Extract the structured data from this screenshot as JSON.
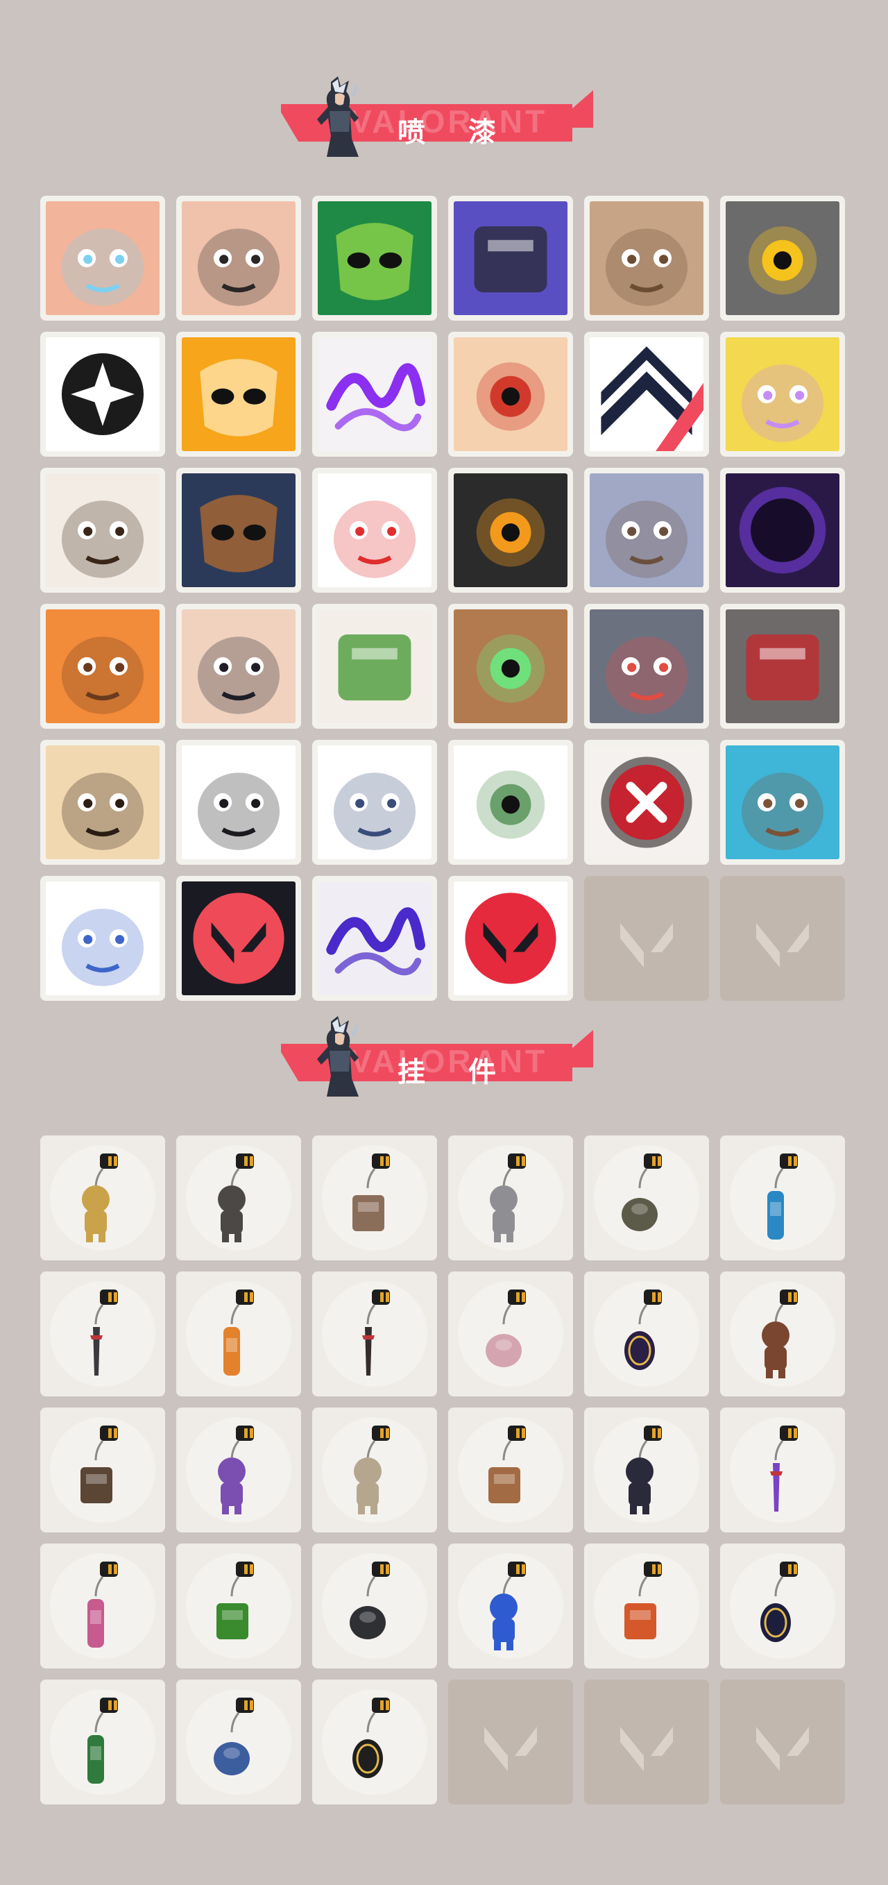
{
  "sections": [
    {
      "title": "喷 漆",
      "banner_ghost_text": "VALORANT"
    },
    {
      "title": "挂 件",
      "banner_ghost_text": "VALORANT"
    }
  ],
  "sprays": [
    {
      "name": "butterfly-face-spray",
      "bg": "#f2b49a",
      "fg": "#7fd0f0",
      "motif": "face"
    },
    {
      "name": "grumpy-face-spray",
      "bg": "#f0c2ab",
      "fg": "#2a2626",
      "motif": "face"
    },
    {
      "name": "green-mask-spray",
      "bg": "#1f8a45",
      "fg": "#94d84a",
      "motif": "mask"
    },
    {
      "name": "purple-robot-spray",
      "bg": "#5a4fc2",
      "fg": "#2c2c3c",
      "motif": "block"
    },
    {
      "name": "brown-penguin-spray",
      "bg": "#c7a486",
      "fg": "#6b4d32",
      "motif": "face"
    },
    {
      "name": "yellow-camera-spray",
      "bg": "#6b6b6b",
      "fg": "#f6c21c",
      "motif": "eye"
    },
    {
      "name": "star-icon-spray",
      "bg": "#ffffff",
      "fg": "#1b1b1b",
      "motif": "star"
    },
    {
      "name": "orange-mask-spray",
      "bg": "#f7a51a",
      "fg": "#ffe7b2",
      "motif": "mask"
    },
    {
      "name": "purple-graffiti-spray",
      "bg": "#f4f2f4",
      "fg": "#8b2ff0",
      "motif": "scribble"
    },
    {
      "name": "goggles-cat-spray",
      "bg": "#f5d1b0",
      "fg": "#d13a2b",
      "motif": "eye"
    },
    {
      "name": "chevron-spray",
      "bg": "#ffffff",
      "fg": "#1d2440",
      "motif": "chevron"
    },
    {
      "name": "sleepy-purple-spray",
      "bg": "#f2d94e",
      "fg": "#c68cf5",
      "motif": "face"
    },
    {
      "name": "pixel-agent-spray",
      "bg": "#f3ece4",
      "fg": "#3a2618",
      "motif": "face"
    },
    {
      "name": "armored-mask-spray",
      "bg": "#2c3a5a",
      "fg": "#b26b2f",
      "motif": "mask"
    },
    {
      "name": "clown-spray",
      "bg": "#ffffff",
      "fg": "#e02d2d",
      "motif": "face"
    },
    {
      "name": "orange-orb-spray",
      "bg": "#2b2b2b",
      "fg": "#f39a1c",
      "motif": "eye"
    },
    {
      "name": "raccoon-spray",
      "bg": "#a0a8c6",
      "fg": "#6b4f3e",
      "motif": "face"
    },
    {
      "name": "purple-void-spray",
      "bg": "#2a1947",
      "fg": "#7a3fe4",
      "motif": "orb"
    },
    {
      "name": "shouting-man-spray",
      "bg": "#f28b3a",
      "fg": "#6a3a1e",
      "motif": "face"
    },
    {
      "name": "anime-boy-spray",
      "bg": "#f0d2bf",
      "fg": "#1e1e26",
      "motif": "face"
    },
    {
      "name": "green-box-spray",
      "bg": "#f3efe8",
      "fg": "#4b9b3a",
      "motif": "block"
    },
    {
      "name": "green-eyes-spray",
      "bg": "#b27a4f",
      "fg": "#6fe07a",
      "motif": "eye"
    },
    {
      "name": "crying-mole-spray",
      "bg": "#6c7180",
      "fg": "#e14c43",
      "motif": "face"
    },
    {
      "name": "red-blade-spray",
      "bg": "#6f6a6a",
      "fg": "#c32a2e",
      "motif": "block"
    },
    {
      "name": "tiger-spray",
      "bg": "#f2d8b0",
      "fg": "#2b1d14",
      "motif": "face"
    },
    {
      "name": "girl-pencil-spray",
      "bg": "#ffffff",
      "fg": "#1c1a1e",
      "motif": "face"
    },
    {
      "name": "beanie-penguin-spray",
      "bg": "#ffffff",
      "fg": "#3a4d7a",
      "motif": "face"
    },
    {
      "name": "frog-spray",
      "bg": "#ffffff",
      "fg": "#6aa06b",
      "motif": "eye"
    },
    {
      "name": "no-symbol-spray",
      "bg": "#f4f1ee",
      "fg": "#c5232f",
      "motif": "cross"
    },
    {
      "name": "wave-bear-spray",
      "bg": "#3fb5d8",
      "fg": "#7a5236",
      "motif": "face"
    },
    {
      "name": "white-hair-agent-spray",
      "bg": "#ffffff",
      "fg": "#3e66c9",
      "motif": "face"
    },
    {
      "name": "valorant-logo-teal-spray",
      "bg": "#1a1a22",
      "fg": "#ef4a58",
      "motif": "vlogo"
    },
    {
      "name": "purple-tag-spray",
      "bg": "#f0eef4",
      "fg": "#4a2acb",
      "motif": "scribble"
    },
    {
      "name": "valorant-logo-red-spray",
      "bg": "#ffffff",
      "fg": "#e52a3d",
      "motif": "vlogo"
    }
  ],
  "charms": [
    {
      "name": "golden-cat-charm",
      "color": "#c9a24a",
      "shape": "figure"
    },
    {
      "name": "robot-drone-charm",
      "color": "#4b4845",
      "shape": "figure"
    },
    {
      "name": "cooking-pot-charm",
      "color": "#8b6e5a",
      "shape": "box"
    },
    {
      "name": "cat-astronaut-charm",
      "color": "#8f8f93",
      "shape": "figure"
    },
    {
      "name": "grenade-pouch-charm",
      "color": "#5c5a49",
      "shape": "round"
    },
    {
      "name": "blue-battery-charm",
      "color": "#2a88c4",
      "shape": "tall"
    },
    {
      "name": "spiked-blade-charm",
      "color": "#3a3a3e",
      "shape": "blade"
    },
    {
      "name": "orange-guitar-charm",
      "color": "#e3812c",
      "shape": "tall"
    },
    {
      "name": "red-rope-charm",
      "color": "#352d2d",
      "shape": "blade"
    },
    {
      "name": "cupcake-charm",
      "color": "#d4a5b0",
      "shape": "round"
    },
    {
      "name": "ep9-medal-purple-charm",
      "color": "#2a1f44",
      "shape": "tag"
    },
    {
      "name": "brown-bear-charm",
      "color": "#7a4630",
      "shape": "figure"
    },
    {
      "name": "wooden-turret-charm",
      "color": "#5b4636",
      "shape": "box"
    },
    {
      "name": "agent-figure-charm",
      "color": "#7a4fb1",
      "shape": "figure"
    },
    {
      "name": "cowboy-robot-charm",
      "color": "#b5a68e",
      "shape": "figure"
    },
    {
      "name": "cardboard-box-charm",
      "color": "#a26b43",
      "shape": "box"
    },
    {
      "name": "dark-tassel-charm",
      "color": "#2a2a3a",
      "shape": "figure"
    },
    {
      "name": "purple-crystal-charm",
      "color": "#7b42c5",
      "shape": "blade"
    },
    {
      "name": "lava-lamp-charm",
      "color": "#c75a8e",
      "shape": "tall"
    },
    {
      "name": "green-pager-charm",
      "color": "#3a8a2e",
      "shape": "box"
    },
    {
      "name": "black-sneaker-charm",
      "color": "#2e3034",
      "shape": "round"
    },
    {
      "name": "blue-astronaut-charm",
      "color": "#2f5bd0",
      "shape": "figure"
    },
    {
      "name": "walkie-talkie-charm",
      "color": "#d4582a",
      "shape": "box"
    },
    {
      "name": "ep9-medal-navy-charm",
      "color": "#1d1d3e",
      "shape": "tag"
    },
    {
      "name": "green-can-charm",
      "color": "#2f7a3c",
      "shape": "tall"
    },
    {
      "name": "ufo-charm",
      "color": "#3c5d9e",
      "shape": "round"
    },
    {
      "name": "gold-tag-charm",
      "color": "#1f1f1f",
      "shape": "tag"
    }
  ]
}
